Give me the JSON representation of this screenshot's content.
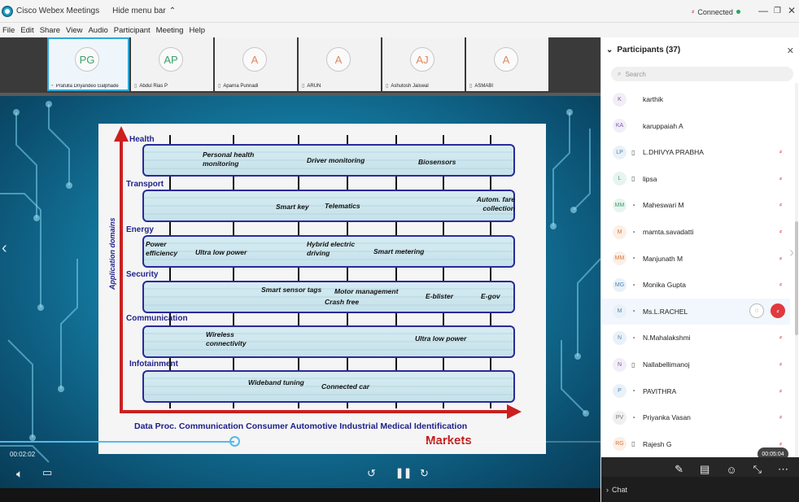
{
  "app": {
    "title": "Cisco Webex Meetings",
    "hide_menu_bar": "Hide menu bar",
    "connection_status": "Connected"
  },
  "menu": [
    "File",
    "Edit",
    "Share",
    "View",
    "Audio",
    "Participant",
    "Meeting",
    "Help"
  ],
  "thumbnails": [
    {
      "initials": "PG",
      "name": "Prafulla Dnyandeo Galphade",
      "color": "green",
      "active": true
    },
    {
      "initials": "AP",
      "name": "Abdul Rias P",
      "color": "green",
      "active": false
    },
    {
      "initials": "A",
      "name": "Aparna Punnadi",
      "color": "orange",
      "active": false
    },
    {
      "initials": "A",
      "name": "ARUN",
      "color": "orange",
      "active": false
    },
    {
      "initials": "AJ",
      "name": "Ashutosh Jaiswal",
      "color": "orange",
      "active": false
    },
    {
      "initials": "A",
      "name": "ASMABI",
      "color": "orange",
      "active": false
    }
  ],
  "slide": {
    "rows": [
      {
        "label": "Health",
        "items": [
          "Personal health monitoring",
          "Driver monitoring",
          "Biosensors"
        ]
      },
      {
        "label": "Transport",
        "items": [
          "Smart key",
          "Telematics",
          "Autom. fare collection"
        ]
      },
      {
        "label": "Energy",
        "items": [
          "Power efficiency",
          "Ultra low power",
          "Hybrid electric driving",
          "Smart metering"
        ]
      },
      {
        "label": "Security",
        "items": [
          "Smart sensor tags",
          "Motor management",
          "Crash free",
          "E-blister",
          "E-gov"
        ]
      },
      {
        "label": "Communication",
        "items": [
          "Wireless connectivity",
          "Ultra low power"
        ]
      },
      {
        "label": "Infotainment",
        "items": [
          "Wideband tuning",
          "Connected car"
        ]
      }
    ],
    "x_axis_text": "Data Proc. Communication Consumer Automotive Industrial Medical Identification",
    "x_axis_title": "Markets",
    "y_axis_title": "Application domains"
  },
  "player": {
    "elapsed": "00:02:02",
    "progress": 0.39
  },
  "participants": {
    "title": "Participants (37)",
    "search_placeholder": "Search",
    "list": [
      {
        "initials": "K",
        "name": "karthik",
        "device": "",
        "muted": false,
        "tone": "purple"
      },
      {
        "initials": "KA",
        "name": "karuppaiah A",
        "device": "",
        "muted": false,
        "tone": "purple"
      },
      {
        "initials": "LP",
        "name": "L.DHIVYA PRABHA",
        "device": "phone",
        "muted": true,
        "tone": "blue"
      },
      {
        "initials": "L",
        "name": "lipsa",
        "device": "phone",
        "muted": true,
        "tone": "green"
      },
      {
        "initials": "MM",
        "name": "Maheswari M",
        "device": "audio",
        "muted": true,
        "tone": "green"
      },
      {
        "initials": "M",
        "name": "mamta.savadatti",
        "device": "audio",
        "muted": true,
        "tone": "orange"
      },
      {
        "initials": "MM",
        "name": "Manjunath M",
        "device": "audio",
        "muted": true,
        "tone": "orange"
      },
      {
        "initials": "MG",
        "name": "Monika Gupta",
        "device": "audio",
        "muted": true,
        "tone": "blue"
      },
      {
        "initials": "M",
        "name": "Ms.L.RACHEL",
        "device": "audio",
        "muted": true,
        "tone": "blue",
        "highlight": true
      },
      {
        "initials": "N",
        "name": "N.Mahalakshmi",
        "device": "audio",
        "muted": true,
        "tone": "blue"
      },
      {
        "initials": "N",
        "name": "Nallabellimanoj",
        "device": "phone",
        "muted": true,
        "tone": "purple"
      },
      {
        "initials": "P",
        "name": "PAVITHRA",
        "device": "audio",
        "muted": true,
        "tone": "blue"
      },
      {
        "initials": "PV",
        "name": "Priyanka Vasan",
        "device": "audio",
        "muted": true,
        "tone": "gray"
      },
      {
        "initials": "RG",
        "name": "Rajesh G",
        "device": "phone",
        "muted": true,
        "tone": "orange"
      }
    ],
    "timer": "00:05:04"
  },
  "chat": {
    "label": "Chat"
  }
}
